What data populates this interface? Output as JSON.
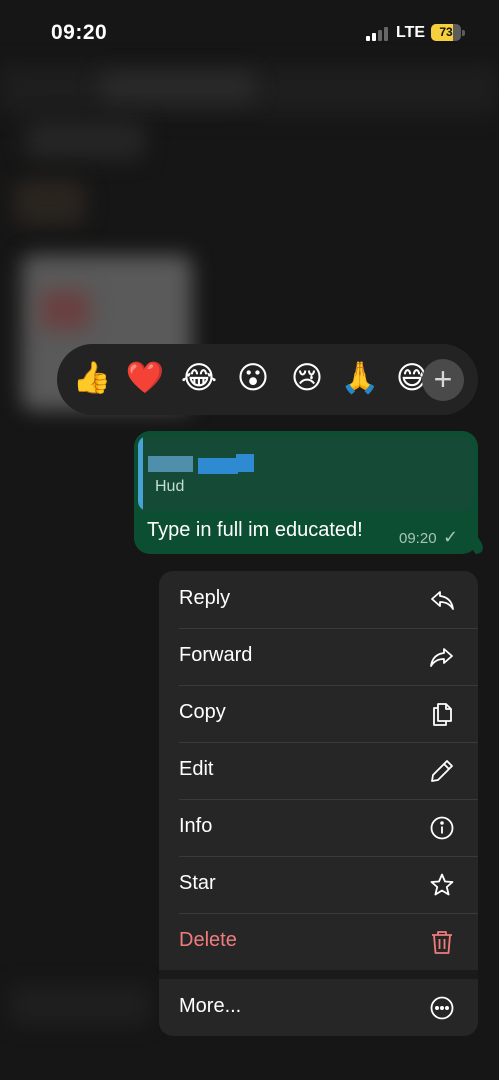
{
  "status_bar": {
    "time": "09:20",
    "network": "LTE",
    "battery": "73"
  },
  "reactions": {
    "emojis": [
      "👍",
      "❤️",
      "😂",
      "😮",
      "😢",
      "🙏",
      "😅"
    ],
    "add_symbol": "+"
  },
  "message": {
    "quoted_author": "Hud",
    "text": "Type in full im educated!",
    "time": "09:20",
    "check": "✓"
  },
  "menu": {
    "items": [
      {
        "label": "Reply",
        "icon": "reply-icon"
      },
      {
        "label": "Forward",
        "icon": "forward-icon"
      },
      {
        "label": "Copy",
        "icon": "copy-icon"
      },
      {
        "label": "Edit",
        "icon": "pencil-icon"
      },
      {
        "label": "Info",
        "icon": "info-icon"
      },
      {
        "label": "Star",
        "icon": "star-icon"
      },
      {
        "label": "Delete",
        "icon": "trash-icon"
      },
      {
        "label": "More...",
        "icon": "more-icon"
      }
    ],
    "delete_color": "#f07c7c"
  },
  "colors": {
    "bubble": "#0b4e32",
    "quote_bar": "#47a3d6",
    "menu_bg": "#262626",
    "battery": "#f7ce3b"
  }
}
